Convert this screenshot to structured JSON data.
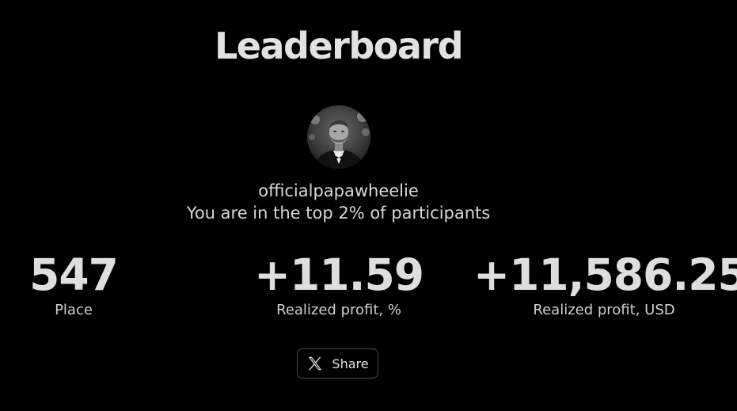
{
  "page": {
    "title": "Leaderboard"
  },
  "user": {
    "username": "officialpapawheelie",
    "rank_text": "You are in the top 2% of participants",
    "avatar": "user-avatar-photo"
  },
  "stats": [
    {
      "value": "547",
      "label": "Place"
    },
    {
      "value": "+11.59",
      "label": "Realized profit, %"
    },
    {
      "value": "+11,586.25",
      "label": "Realized profit, USD"
    }
  ],
  "share": {
    "label": "Share",
    "icon": "x-logo-icon"
  },
  "colors": {
    "background": "#000000",
    "text": "#dcdcdc",
    "button_border": "#4a4a4a"
  }
}
